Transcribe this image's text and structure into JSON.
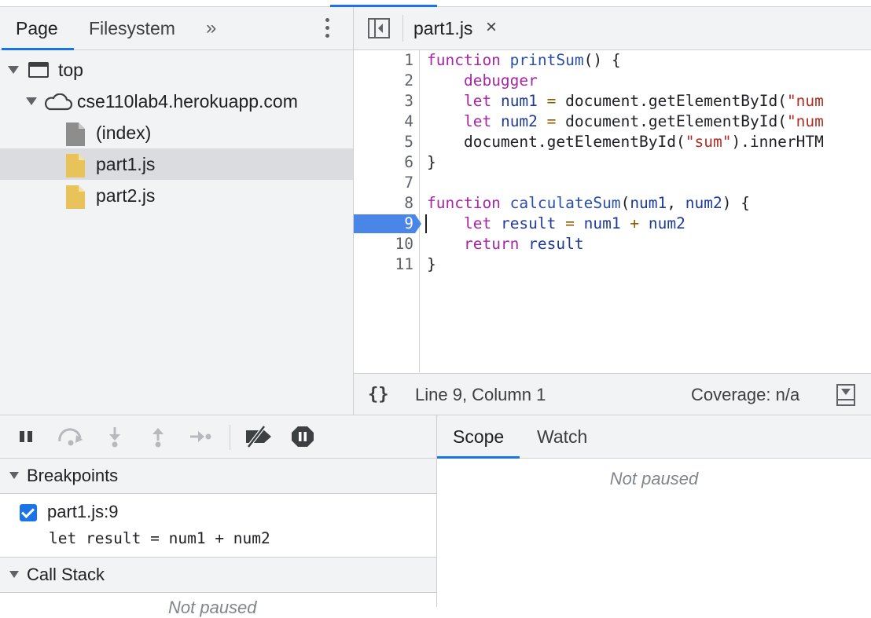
{
  "navigator": {
    "tabs": [
      "Page",
      "Filesystem"
    ],
    "more": "»",
    "tree": [
      {
        "label": "top",
        "icon": "frame-icon",
        "expanded": true
      },
      {
        "label": "cse110lab4.herokuapp.com",
        "icon": "cloud-icon",
        "expanded": true
      },
      {
        "label": "(index)",
        "icon": "document-icon"
      },
      {
        "label": "part1.js",
        "icon": "script-file-icon",
        "selected": true
      },
      {
        "label": "part2.js",
        "icon": "script-file-icon"
      }
    ]
  },
  "editor": {
    "tab_title": "part1.js",
    "close": "×",
    "lines": [
      "1",
      "2",
      "3",
      "4",
      "5",
      "6",
      "7",
      "8",
      "9",
      "10",
      "11"
    ],
    "breakpoint_line": "9",
    "status": {
      "pretty_print": "{}",
      "position": "Line 9, Column 1",
      "coverage": "Coverage: n/a"
    }
  },
  "code": {
    "l1": {
      "k": "function",
      "f": "printSum",
      "rest": "() {"
    },
    "l2": {
      "k": "debugger"
    },
    "l3": {
      "k": "let",
      "v": "num1",
      "op": "=",
      "rest": "document.getElementById(",
      "s": "\"num"
    },
    "l4": {
      "k": "let",
      "v": "num2",
      "op": "=",
      "rest": "document.getElementById(",
      "s": "\"num"
    },
    "l5": {
      "rest1": "document.getElementById(",
      "s": "\"sum\"",
      "rest2": ").innerHTM"
    },
    "l6": "}",
    "l8": {
      "k": "function",
      "f": "calculateSum",
      "p1": "num1",
      "p2": "num2",
      "rest": ") {"
    },
    "l9": {
      "k": "let",
      "v": "result",
      "op": "=",
      "a": "num1",
      "plus": "+",
      "b": "num2"
    },
    "l10": {
      "k": "return",
      "v": "result"
    },
    "l11": "}"
  },
  "debugger": {
    "breakpoints_title": "Breakpoints",
    "breakpoint": {
      "name": "part1.js:9",
      "code": "let result = num1 + num2",
      "checked": true
    },
    "callstack_title": "Call Stack",
    "callstack_status": "Not paused"
  },
  "sidebar": {
    "tabs": [
      "Scope",
      "Watch"
    ],
    "status": "Not paused"
  },
  "colors": {
    "accent": "#1a73e8",
    "breakpoint": "#4a86e8",
    "keyword": "#a626a4",
    "string": "#b32d23",
    "file_yellow": "#e8c35a"
  }
}
